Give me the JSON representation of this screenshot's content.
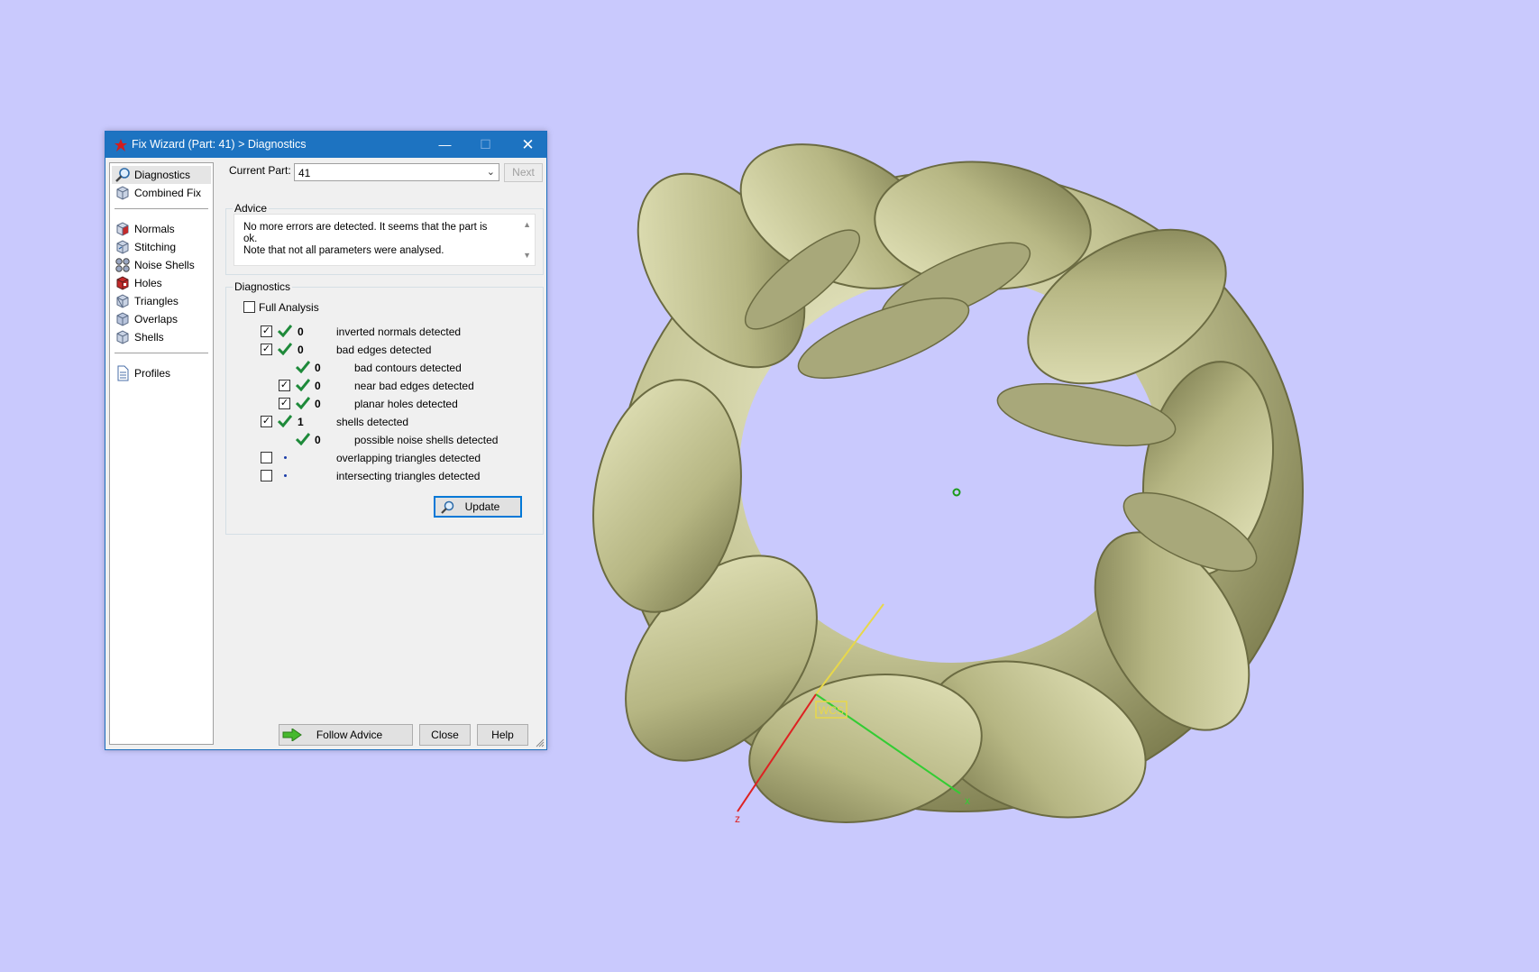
{
  "window": {
    "title": "Fix Wizard (Part: 41) > Diagnostics",
    "minimize": "—",
    "maximize": "☐",
    "close": "✕"
  },
  "nav": {
    "items": [
      {
        "label": "Diagnostics",
        "icon": "magnifier-icon"
      },
      {
        "label": "Combined Fix",
        "icon": "cube-icon"
      },
      {
        "label": "Normals",
        "icon": "normals-cube-icon"
      },
      {
        "label": "Stitching",
        "icon": "stitching-cube-icon"
      },
      {
        "label": "Noise Shells",
        "icon": "noise-shells-icon"
      },
      {
        "label": "Holes",
        "icon": "holes-cube-icon"
      },
      {
        "label": "Triangles",
        "icon": "triangles-cube-icon"
      },
      {
        "label": "Overlaps",
        "icon": "overlaps-cube-icon"
      },
      {
        "label": "Shells",
        "icon": "shells-cube-icon"
      },
      {
        "label": "Profiles",
        "icon": "document-icon"
      }
    ]
  },
  "current_part": {
    "label": "Current Part:",
    "value": "41",
    "next": "Next"
  },
  "advice": {
    "title": "Advice",
    "line1": "No more errors are detected. It seems that the part is ok.",
    "line2": "Note that not all parameters were analysed."
  },
  "diagnostics": {
    "title": "Diagnostics",
    "full_analysis": "Full Analysis",
    "rows": [
      {
        "count": "0",
        "label": "inverted normals detected",
        "checked": true
      },
      {
        "count": "0",
        "label": "bad edges detected",
        "checked": true
      },
      {
        "count": "0",
        "label": "bad contours detected"
      },
      {
        "count": "0",
        "label": "near bad edges detected",
        "checked": true
      },
      {
        "count": "0",
        "label": "planar holes detected",
        "checked": true
      },
      {
        "count": "1",
        "label": "shells detected",
        "checked": true
      },
      {
        "count": "0",
        "label": "possible noise shells detected"
      },
      {
        "label": "overlapping triangles detected",
        "checked": false
      },
      {
        "label": "intersecting triangles detected",
        "checked": false
      }
    ],
    "update": "Update"
  },
  "footer": {
    "follow_advice": "Follow Advice",
    "close": "Close",
    "help": "Help"
  },
  "viewport": {
    "wcs_label": "WCS",
    "axis_x": "x",
    "axis_z": "z",
    "background": "#c9c9fd",
    "model_color": "#c7c79a"
  }
}
